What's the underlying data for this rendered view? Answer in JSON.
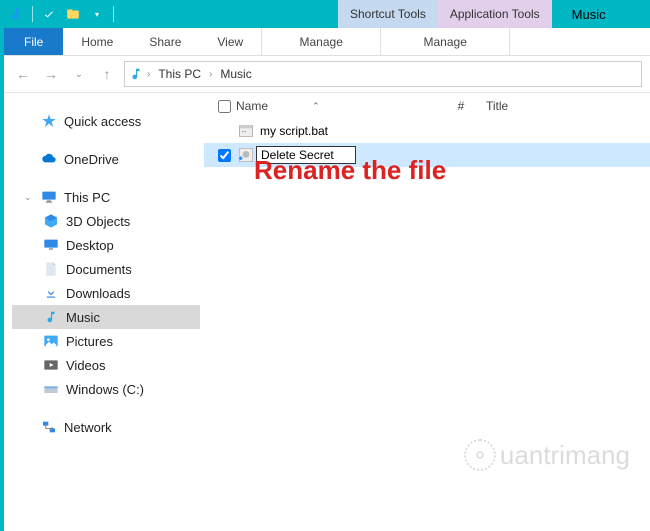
{
  "titlebar": {
    "context_tabs": {
      "shortcut": "Shortcut Tools",
      "application": "Application Tools"
    },
    "title": "Music"
  },
  "ribbon": {
    "file": "File",
    "home": "Home",
    "share": "Share",
    "view": "View",
    "manage1": "Manage",
    "manage2": "Manage"
  },
  "breadcrumb": {
    "root": "This PC",
    "current": "Music"
  },
  "tree": {
    "quick_access": "Quick access",
    "onedrive": "OneDrive",
    "this_pc": "This PC",
    "objects3d": "3D Objects",
    "desktop": "Desktop",
    "documents": "Documents",
    "downloads": "Downloads",
    "music": "Music",
    "pictures": "Pictures",
    "videos": "Videos",
    "windows_c": "Windows (C:)",
    "network": "Network"
  },
  "columns": {
    "name": "Name",
    "num": "#",
    "title": "Title"
  },
  "files": {
    "row0": {
      "name": "my script.bat"
    },
    "row1": {
      "rename_value": "Delete Secret"
    }
  },
  "annotation": "Rename the file",
  "watermark": "uantrimang"
}
